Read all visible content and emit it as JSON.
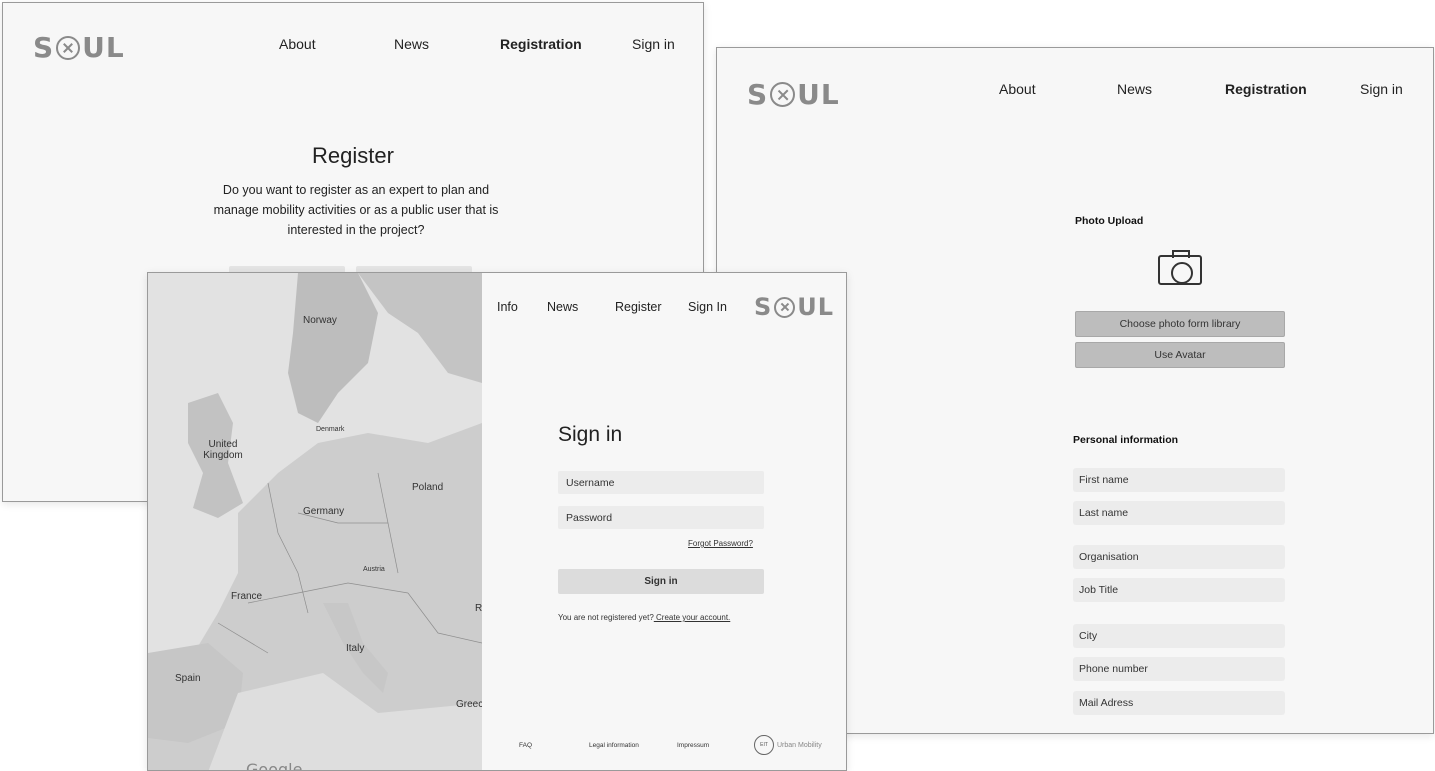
{
  "register_page": {
    "logo": {
      "pre": "S",
      "post": "UL"
    },
    "nav": {
      "about": "About",
      "news": "News",
      "registration": "Registration",
      "sign_in": "Sign in"
    },
    "title": "Register",
    "description": "Do you want to register as an expert to plan and manage mobility activities or as a public user that is interested in the project?"
  },
  "registration_form": {
    "logo": {
      "pre": "S",
      "post": "UL"
    },
    "nav": {
      "about": "About",
      "news": "News",
      "registration": "Registration",
      "sign_in": "Sign in"
    },
    "photo_upload": {
      "label": "Photo Upload",
      "icon": "camera-icon",
      "choose_button": "Choose photo form library",
      "avatar_button": "Use Avatar"
    },
    "personal_information": {
      "label": "Personal information",
      "first_name": "First name",
      "last_name": "Last name",
      "organisation": "Organisation",
      "job_title": "Job Title",
      "city": "City",
      "phone": "Phone number",
      "mail": "Mail Adress"
    }
  },
  "signin_page": {
    "nav": {
      "info": "Info",
      "news": "News",
      "register": "Register",
      "sign_in": "Sign In"
    },
    "logo": {
      "pre": "S",
      "post": "UL"
    },
    "title": "Sign in",
    "username_placeholder": "Username",
    "password_placeholder": "Password",
    "forgot_password": "Forgot Password?",
    "sign_in_button": "Sign in",
    "not_registered": "You are not registered yet?",
    "create_account": " Create your account.",
    "map": {
      "labels": {
        "norway": "Norway",
        "denmark": "Denmark",
        "united_kingdom": "United Kingdom",
        "poland": "Poland",
        "germany": "Germany",
        "austria": "Austria",
        "france": "France",
        "italy": "Italy",
        "spain": "Spain",
        "greece": "Greec",
        "r": "R"
      },
      "attribution": "Google"
    },
    "footer": {
      "faq": "FAQ",
      "legal": "Legal information",
      "impressum": "Impressum",
      "urban_mobility_badge": "EIT",
      "urban_mobility": "Urban Mobility"
    }
  },
  "colors": {
    "logo_gray": "#8a8a8a",
    "button_gray": "#bdbdbd",
    "field_gray": "#ececec",
    "page_bg": "#f7f7f7"
  }
}
